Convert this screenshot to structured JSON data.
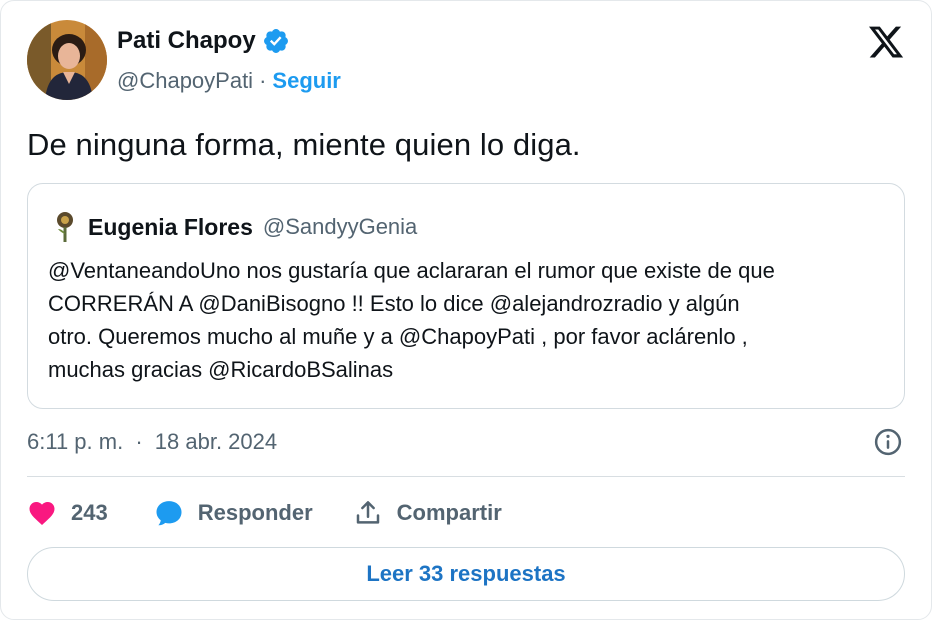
{
  "author": {
    "name": "Pati Chapoy",
    "handle": "@ChapoyPati",
    "separator": "·",
    "follow_label": "Seguir",
    "verified": true
  },
  "tweet": {
    "text": "De ninguna forma, miente quien lo diga.",
    "time": "6:11 p. m.",
    "date_separator": "·",
    "date": "18 abr. 2024"
  },
  "quoted": {
    "name": "Eugenia Flores",
    "handle": "@SandyyGenia",
    "lines": [
      "@VentaneandoUno nos gustaría que aclararan el rumor que existe de que",
      "CORRERÁN A @DaniBisogno !! Esto lo dice @alejandrozradio y algún",
      "otro. Queremos mucho al muñe y a @ChapoyPati , por favor aclárenlo ,",
      "muchas gracias @RicardoBSalinas"
    ]
  },
  "actions": {
    "likes": "243",
    "reply_label": "Responder",
    "share_label": "Compartir"
  },
  "read_replies_label": "Leer 33 respuestas",
  "colors": {
    "accent": "#1d9bf0",
    "heart": "#f91880",
    "muted": "#536471",
    "text": "#0f1419"
  },
  "icons": {
    "brand": "x-logo-icon",
    "verified": "verified-badge-icon",
    "info": "info-icon",
    "like": "heart-icon",
    "reply": "speech-bubble-icon",
    "share": "share-upload-icon"
  }
}
